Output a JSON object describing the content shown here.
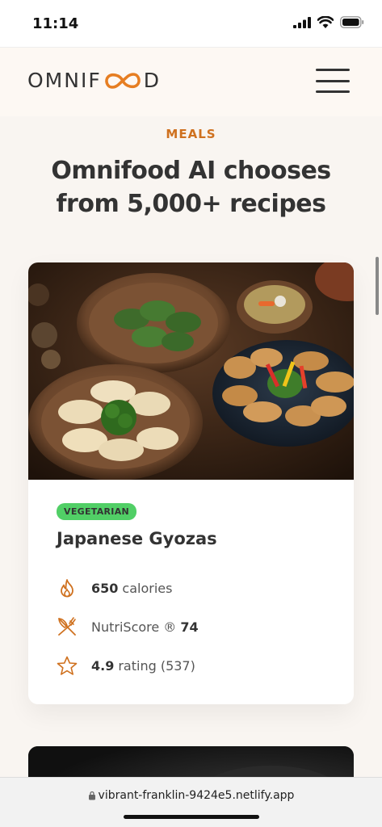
{
  "status": {
    "time": "11:14"
  },
  "header": {
    "logo_left": "OMNIF",
    "logo_right": "D"
  },
  "section": {
    "subheading": "MEALS",
    "heading": "Omnifood AI chooses from 5,000+ recipes"
  },
  "meal": {
    "tag": "VEGETARIAN",
    "title": "Japanese Gyozas",
    "calories_value": "650",
    "calories_label": "calories",
    "nutri_label": "NutriScore ®",
    "nutri_value": "74",
    "rating_value": "4.9",
    "rating_label": "rating (537)"
  },
  "browser": {
    "url": "vibrant-franklin-9424e5.netlify.app"
  },
  "colors": {
    "accent": "#cf711f",
    "tag_green": "#51cf66",
    "text": "#333333"
  }
}
